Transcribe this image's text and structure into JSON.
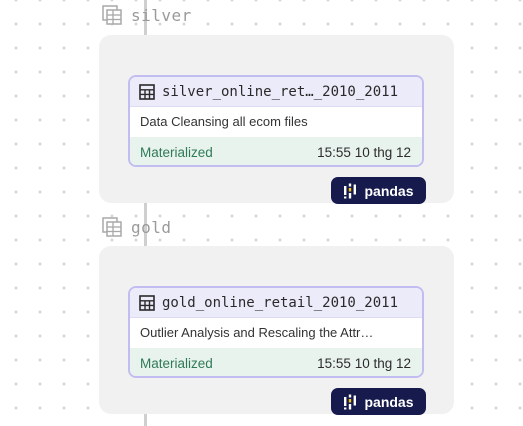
{
  "groups": [
    {
      "name": "silver",
      "asset": {
        "title": "silver_online_ret…_2010_2011",
        "description": "Data Cleansing all ecom files",
        "status": "Materialized",
        "timestamp": "15:55 10 thg 12",
        "kind": "pandas"
      }
    },
    {
      "name": "gold",
      "asset": {
        "title": "gold_online_retail_2010_2011",
        "description": "Outlier Analysis and Rescaling the Attr…",
        "status": "Materialized",
        "timestamp": "15:55 10 thg 12",
        "kind": "pandas"
      }
    }
  ],
  "icons": {
    "group": "group-folder-icon",
    "asset": "table-icon",
    "kind": "pandas-logo-icon"
  },
  "colors": {
    "accent_border": "#c2bdf0",
    "status_green": "#2f7a55",
    "badge_bg": "#161a4c"
  }
}
